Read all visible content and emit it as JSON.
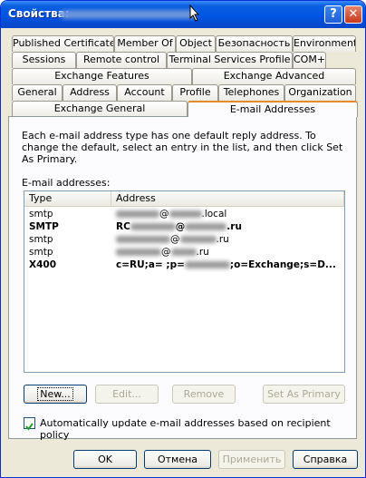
{
  "window": {
    "title": "Свойства:"
  },
  "tabs": {
    "row1": [
      "Published Certificates",
      "Member Of",
      "Object",
      "Безопасность",
      "Environment"
    ],
    "row2": [
      "Sessions",
      "Remote control",
      "Terminal Services Profile",
      "COM+"
    ],
    "row3": [
      "Exchange Features",
      "Exchange Advanced"
    ],
    "row4": [
      "General",
      "Address",
      "Account",
      "Profile",
      "Telephones",
      "Organization"
    ],
    "row5": [
      "Exchange General",
      "E-mail Addresses"
    ],
    "active": "E-mail Addresses"
  },
  "panel": {
    "description": "Each e-mail address type has one default reply address. To change the default, select an entry in the list, and then click Set As Primary.",
    "list_label": "E-mail addresses:",
    "columns": [
      "Type",
      "Address"
    ],
    "rows": [
      {
        "type": "smtp",
        "address_pre": "",
        "address_mid": "@",
        "address_post": ".local",
        "bold": false
      },
      {
        "type": "SMTP",
        "address_pre": "RC",
        "address_mid": "@",
        "address_post": ".ru",
        "bold": true
      },
      {
        "type": "smtp",
        "address_pre": "",
        "address_mid": "@",
        "address_post": ".ru",
        "bold": false
      },
      {
        "type": "smtp",
        "address_pre": "",
        "address_mid": "@",
        "address_post": ".ru",
        "bold": false
      },
      {
        "type": "X400",
        "address_pre": "c=RU;a= ;p=",
        "address_mid": "",
        "address_post": ";o=Exchange;s=D...",
        "bold": true
      }
    ],
    "buttons": {
      "new": "New...",
      "edit": "Edit...",
      "remove": "Remove",
      "set_primary": "Set As Primary"
    },
    "auto_update": {
      "label": "Automatically update e-mail addresses based on recipient policy",
      "checked": true
    }
  },
  "footer": {
    "ok": "OK",
    "cancel": "Отмена",
    "apply": "Применить",
    "help": "Справка"
  }
}
